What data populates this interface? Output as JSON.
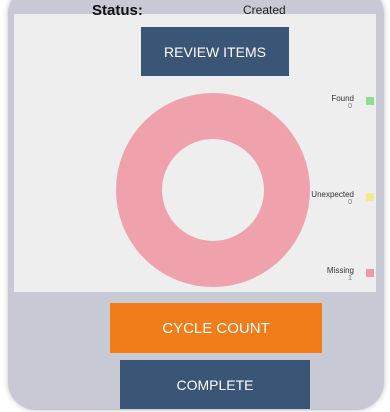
{
  "status": {
    "label": "Status:",
    "value": "Created"
  },
  "buttons": {
    "review_items": "REVIEW ITEMS",
    "cycle_count": "CYCLE COUNT",
    "complete": "COMPLETE"
  },
  "legend": [
    {
      "label": "Found",
      "count": "0",
      "color": "#8fdc8f"
    },
    {
      "label": "Unexpected",
      "count": "0",
      "color": "#f0ec8c"
    },
    {
      "label": "Missing",
      "count": "1",
      "color": "#ef9aa6"
    }
  ],
  "donut": {
    "color": "#efa2ab",
    "found": 0,
    "unexpected": 0,
    "missing": 1
  },
  "colors": {
    "primary_button": "#3b5576",
    "accent_button": "#f07d1a",
    "background": "#c7c9d4",
    "panel": "#eeeeee"
  }
}
